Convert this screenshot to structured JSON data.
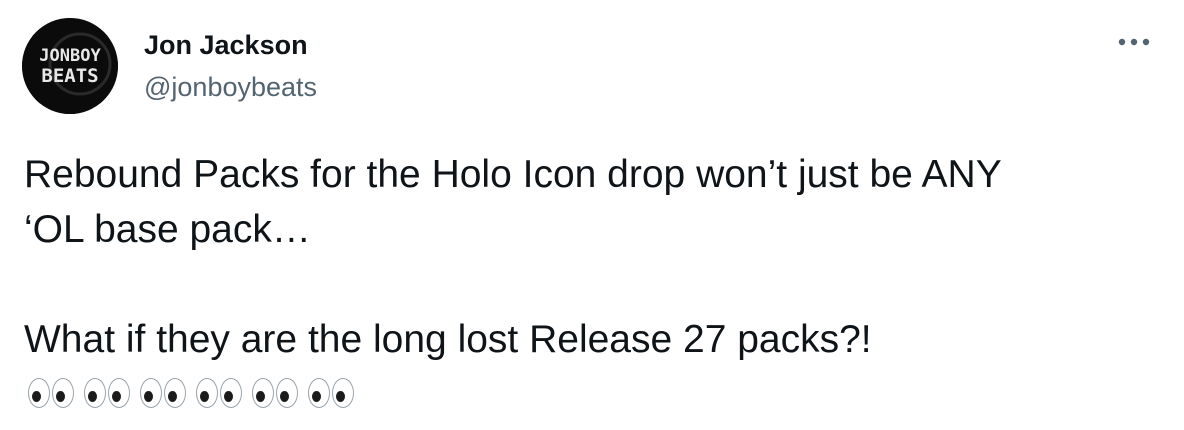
{
  "author": {
    "avatar_text_line1": "JONBOY",
    "avatar_text_line2": "BEATS",
    "display_name": "Jon Jackson",
    "handle": "@jonboybeats"
  },
  "more_icon": "more-horizontal-icon",
  "tweet": {
    "line1": "Rebound Packs for the Holo Icon drop won’t just be ANY",
    "line2": "‘OL base pack…",
    "line3": "What if they are the long lost Release 27 packs?!",
    "emoji": "eyes",
    "emoji_count": 6
  },
  "colors": {
    "text": "#0f1419",
    "secondary": "#536471",
    "avatar_bg": "#0b0b0b"
  }
}
